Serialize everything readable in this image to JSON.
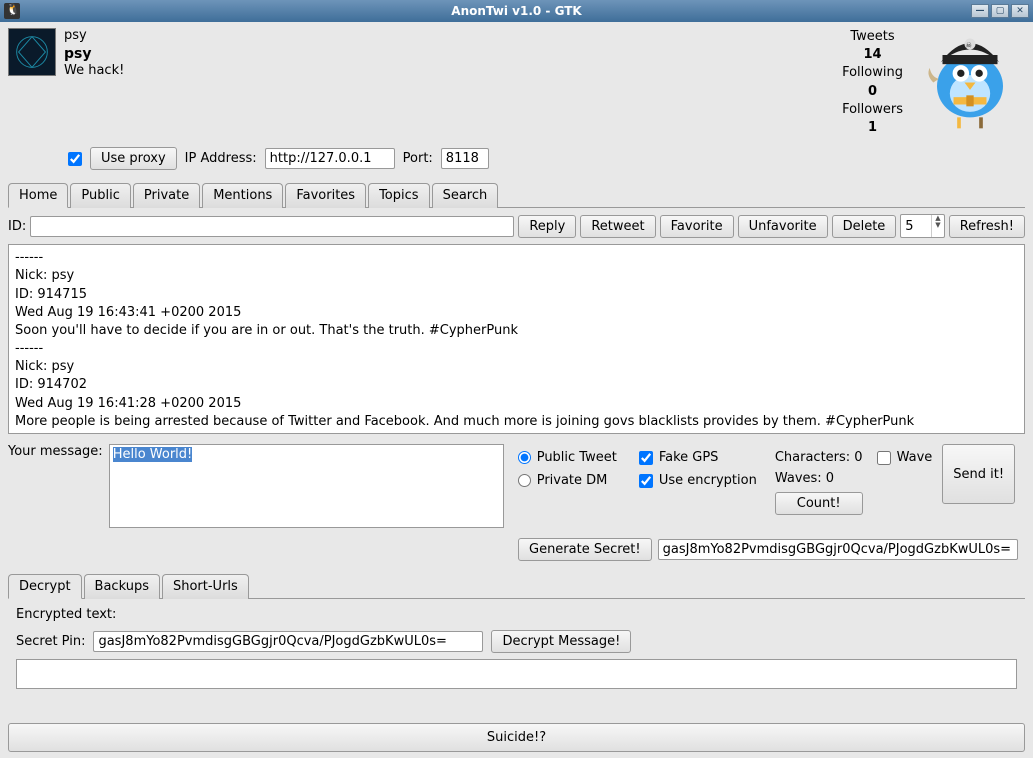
{
  "window": {
    "title": "AnonTwi v1.0 - GTK"
  },
  "profile": {
    "handle": "psy",
    "name": "psy",
    "bio": "We hack!"
  },
  "stats": {
    "tweets_label": "Tweets",
    "tweets_value": "14",
    "following_label": "Following",
    "following_value": "0",
    "followers_label": "Followers",
    "followers_value": "1"
  },
  "proxy": {
    "use_proxy_label": "Use proxy",
    "ip_label": "IP Address:",
    "ip_value": "http://127.0.0.1",
    "port_label": "Port:",
    "port_value": "8118"
  },
  "tabs": {
    "home": "Home",
    "public": "Public",
    "private": "Private",
    "mentions": "Mentions",
    "favorites": "Favorites",
    "topics": "Topics",
    "search": "Search"
  },
  "actions": {
    "id_label": "ID:",
    "reply": "Reply",
    "retweet": "Retweet",
    "favorite": "Favorite",
    "unfavorite": "Unfavorite",
    "delete": "Delete",
    "refresh": "Refresh!",
    "count_value": "5"
  },
  "feed": [
    "------",
    "Nick: psy",
    "ID: 914715",
    "Wed Aug 19 16:43:41 +0200 2015",
    "Soon you'll have to decide if you are in or out. That's the truth. #CypherPunk",
    "------",
    "Nick: psy",
    "ID: 914702",
    "Wed Aug 19 16:41:28 +0200 2015",
    "More people is being arrested because of Twitter and Facebook. And much more is joining govs blacklists provides by them. #CypherPunk"
  ],
  "compose": {
    "your_message_label": "Your message:",
    "message_value": "Hello World!",
    "public_tweet": "Public Tweet",
    "private_dm": "Private DM",
    "fake_gps": "Fake GPS",
    "use_encryption": "Use encryption",
    "chars_label": "Characters: 0",
    "waves_label": "Waves: 0",
    "count_btn": "Count!",
    "wave_label": "Wave",
    "send_btn": "Send it!"
  },
  "secret": {
    "generate_btn": "Generate Secret!",
    "value": "gasJ8mYo82PvmdisgGBGgjr0Qcva/PJogdGzbKwUL0s="
  },
  "tabs2": {
    "decrypt": "Decrypt",
    "backups": "Backups",
    "shorturls": "Short-Urls"
  },
  "decrypt": {
    "encrypted_label": "Encrypted text:",
    "pin_label": "Secret Pin:",
    "pin_value": "gasJ8mYo82PvmdisgGBGgjr0Qcva/PJogdGzbKwUL0s=",
    "decrypt_btn": "Decrypt Message!"
  },
  "suicide": "Suicide!?"
}
